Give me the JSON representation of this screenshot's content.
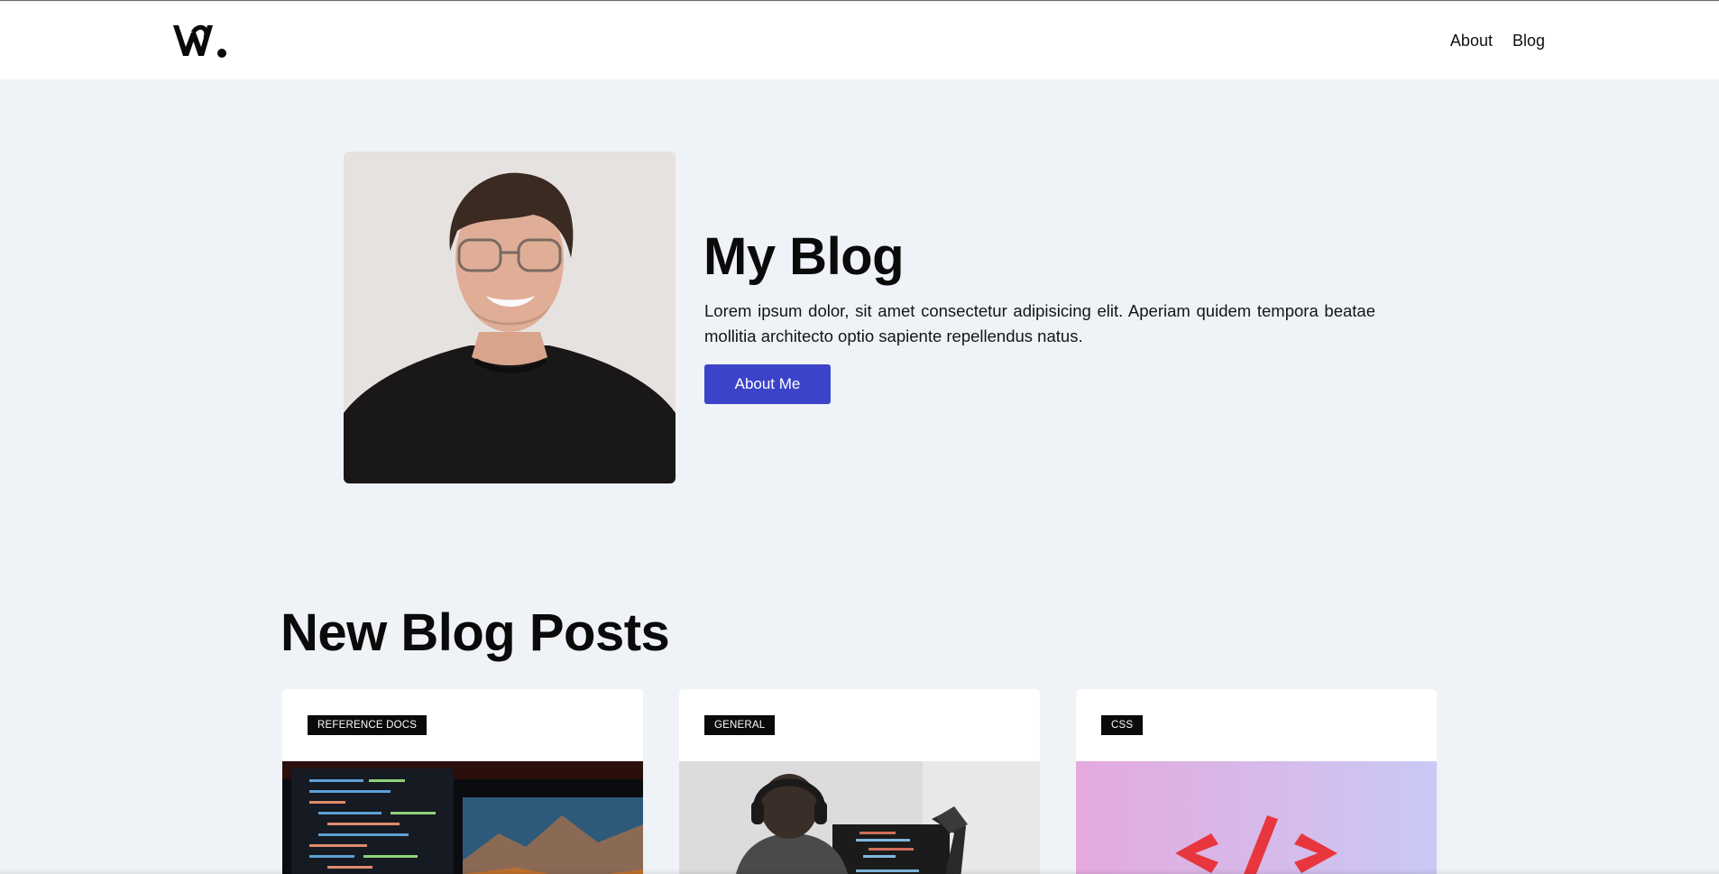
{
  "nav": {
    "logo_icon": "w-dot-logo",
    "links": [
      "About",
      "Blog"
    ]
  },
  "hero": {
    "title": "My Blog",
    "description": "Lorem ipsum dolor, sit amet consectetur adipisicing elit. Aperiam quidem tempora beatae mollitia architecto optio sapiente repellendus natus.",
    "button_label": "About Me",
    "accent_color": "#3b44c9"
  },
  "posts": {
    "title": "New Blog Posts",
    "cards": [
      {
        "tag": "REFERENCE DOCS",
        "image": "code-screens-mountain-photo"
      },
      {
        "tag": "GENERAL",
        "image": "developer-headphones-photo"
      },
      {
        "tag": "CSS",
        "image": "code-brackets-3d-photo"
      }
    ]
  }
}
